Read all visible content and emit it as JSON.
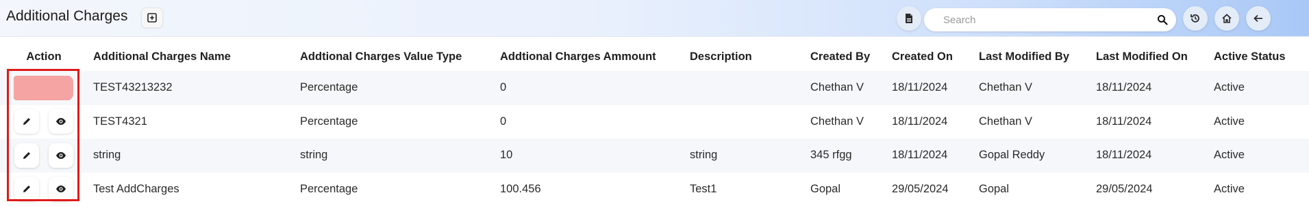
{
  "header": {
    "title": "Additional Charges",
    "search_placeholder": "Search",
    "icons": [
      "plus-square-icon",
      "pdf-file-icon",
      "search-icon",
      "history-icon",
      "home-icon",
      "arrow-left-icon"
    ]
  },
  "table": {
    "columns": [
      "Action",
      "Additional Charges Name",
      "Addtional Charges Value Type",
      "Addtional Charges Ammount",
      "Description",
      "Created By",
      "Created On",
      "Last Modified By",
      "Last Modified On",
      "Active Status"
    ],
    "rows": [
      [
        "TEST43213232",
        "Percentage",
        "0",
        "",
        "Chethan V",
        "18/11/2024",
        "Chethan V",
        "18/11/2024",
        "Active"
      ],
      [
        "TEST4321",
        "Percentage",
        "0",
        "",
        "Chethan V",
        "18/11/2024",
        "Chethan V",
        "18/11/2024",
        "Active"
      ],
      [
        "string",
        "string",
        "10",
        "string",
        "345 rfgg",
        "18/11/2024",
        "Gopal Reddy",
        "18/11/2024",
        "Active"
      ],
      [
        "Test AddCharges",
        "Percentage",
        "100.456",
        "Test1",
        "Gopal",
        "29/05/2024",
        "Gopal",
        "29/05/2024",
        "Active"
      ]
    ],
    "highlighted_row": 0
  },
  "colors": {
    "highlight": "#f5a3a3",
    "frame": "#e01919",
    "header_gradient_end": "#a9c8f6"
  }
}
